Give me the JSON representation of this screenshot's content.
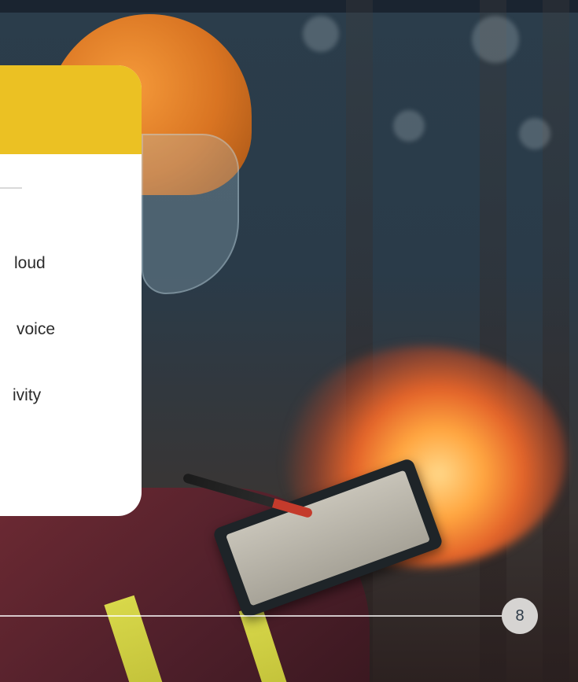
{
  "card": {
    "lines": [
      "loud",
      "voice",
      "ivity"
    ]
  },
  "footer": {
    "page_number": "8"
  },
  "colors": {
    "card_header": "#ebc123",
    "card_body": "#ffffff",
    "badge_bg": "#d6d4d2",
    "badge_text": "#2d3a47"
  }
}
